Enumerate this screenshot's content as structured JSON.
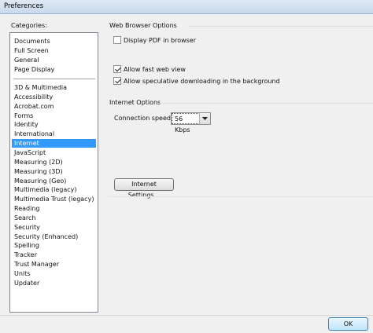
{
  "window": {
    "title": "Preferences"
  },
  "categories": {
    "label": "Categories:",
    "top_items": [
      "Documents",
      "Full Screen",
      "General",
      "Page Display"
    ],
    "items": [
      "3D & Multimedia",
      "Accessibility",
      "Acrobat.com",
      "Forms",
      "Identity",
      "International",
      "Internet",
      "JavaScript",
      "Measuring (2D)",
      "Measuring (3D)",
      "Measuring (Geo)",
      "Multimedia (legacy)",
      "Multimedia Trust (legacy)",
      "Reading",
      "Search",
      "Security",
      "Security (Enhanced)",
      "Spelling",
      "Tracker",
      "Trust Manager",
      "Units",
      "Updater"
    ],
    "selected": "Internet"
  },
  "web_browser_options": {
    "title": "Web Browser Options",
    "display_pdf": {
      "label": "Display PDF in browser",
      "checked": false
    },
    "fast_web_view": {
      "label": "Allow fast web view",
      "checked": true
    },
    "speculative_download": {
      "label": "Allow speculative downloading in the background",
      "checked": true
    }
  },
  "internet_options": {
    "title": "Internet Options",
    "connection_speed_label": "Connection speed:",
    "connection_speed_value": "56 Kbps",
    "internet_settings_button": "Internet Settings..."
  },
  "footer": {
    "ok_label": "OK"
  },
  "colors": {
    "selection": "#3399ff",
    "title_bar": "#dfe9f5"
  }
}
